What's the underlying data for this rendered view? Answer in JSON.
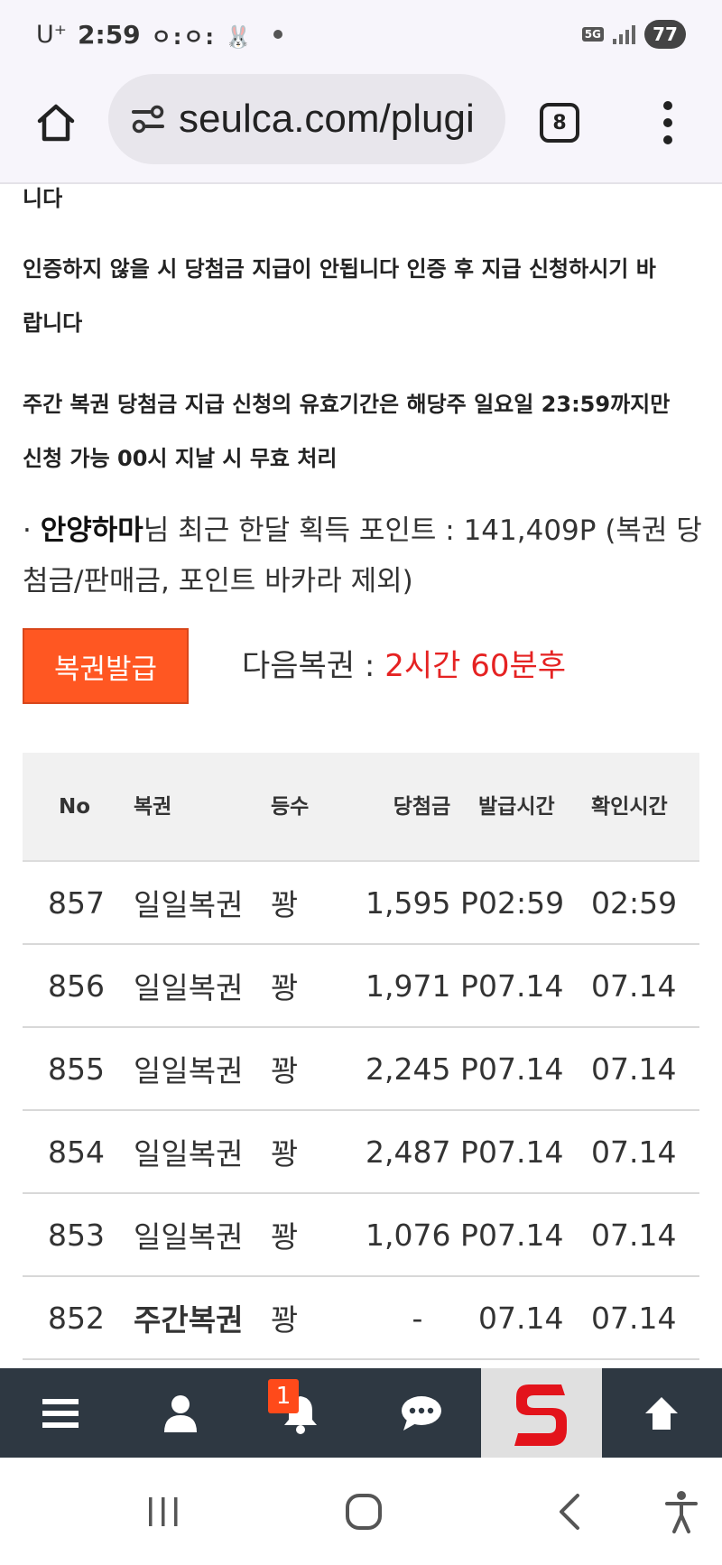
{
  "status_bar": {
    "carrier": "U⁺",
    "time": "2:59",
    "notification_icons": "ㅇ:ㅇ: 🐰",
    "network": "5G",
    "battery": "77"
  },
  "browser": {
    "url": "seulca.com/plugi",
    "tab_count": "8"
  },
  "notices": {
    "line0": "니다",
    "line1a": "인증하지 않을 시 당첨금 지급이 안됩니다 인증 후 지급 신청하시기 바",
    "line1b": "랍니다",
    "line2a": "주간 복권 당첨금 지급 신청의 유효기간은 해당주 일요일 23:59까지만",
    "line2b": "신청 가능 00시 지날 시 무효 처리"
  },
  "points": {
    "bullet": "·",
    "nickname": "안양하마",
    "text": "님 최근 한달 획득 포인트 : 141,409P (복권 당첨금/판매금, 포인트 바카라 제외)"
  },
  "issue_button": "복권발급",
  "next_lottery": {
    "label": "다음복권 : ",
    "value": "2시간 60분후"
  },
  "table": {
    "headers": {
      "no": "No",
      "type": "복권",
      "rank": "등수",
      "prize": "당첨금",
      "issued": "발급시간",
      "checked": "확인시간"
    },
    "rows": [
      {
        "no": "857",
        "type": "일일복권",
        "rank": "꽝",
        "prize": "1,595 P",
        "issued": "02:59",
        "checked": "02:59"
      },
      {
        "no": "856",
        "type": "일일복권",
        "rank": "꽝",
        "prize": "1,971 P",
        "issued": "07.14",
        "checked": "07.14"
      },
      {
        "no": "855",
        "type": "일일복권",
        "rank": "꽝",
        "prize": "2,245 P",
        "issued": "07.14",
        "checked": "07.14"
      },
      {
        "no": "854",
        "type": "일일복권",
        "rank": "꽝",
        "prize": "2,487 P",
        "issued": "07.14",
        "checked": "07.14"
      },
      {
        "no": "853",
        "type": "일일복권",
        "rank": "꽝",
        "prize": "1,076 P",
        "issued": "07.14",
        "checked": "07.14"
      },
      {
        "no": "852",
        "type": "주간복권",
        "rank": "꽝",
        "prize": "-",
        "issued": "07.14",
        "checked": "07.14"
      }
    ]
  },
  "bottom_nav": {
    "items": [
      "menu-icon",
      "user-icon",
      "bell-icon",
      "chat-icon",
      "site-logo",
      "arrow-up-icon"
    ],
    "notification_count": "1"
  },
  "colors": {
    "accent": "#ff5722",
    "next_value": "#e52222",
    "nav_bg": "#2e3842",
    "badge": "#ff4a1a",
    "logo_red": "#e3131b"
  }
}
